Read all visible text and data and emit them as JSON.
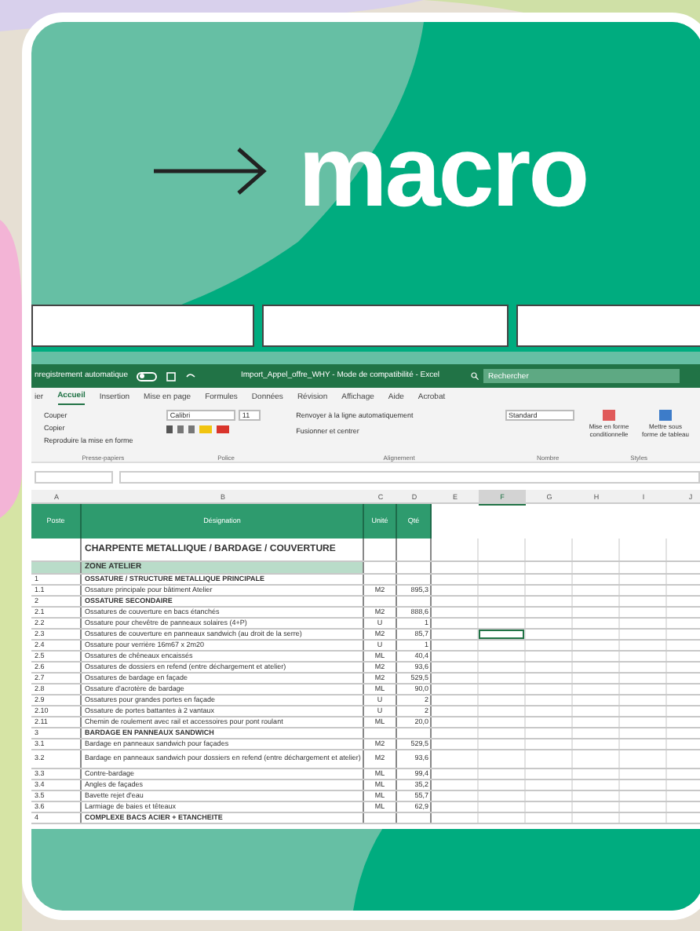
{
  "headline": {
    "word": "macro"
  },
  "excel": {
    "title_bar": {
      "autosave_label": "nregistrement automatique",
      "autosave_on": false,
      "file_title": "Import_Appel_offre_WHY  -  Mode de compatibilité  -  Excel",
      "search_placeholder": "Rechercher"
    },
    "tabs": [
      {
        "label": "ier",
        "selected": false
      },
      {
        "label": "Accueil",
        "selected": true
      },
      {
        "label": "Insertion",
        "selected": false
      },
      {
        "label": "Mise en page",
        "selected": false
      },
      {
        "label": "Formules",
        "selected": false
      },
      {
        "label": "Données",
        "selected": false
      },
      {
        "label": "Révision",
        "selected": false
      },
      {
        "label": "Affichage",
        "selected": false
      },
      {
        "label": "Aide",
        "selected": false
      },
      {
        "label": "Acrobat",
        "selected": false
      }
    ],
    "ribbon": {
      "clipboard": [
        "Couper",
        "Copier",
        "Reproduire la mise en forme"
      ],
      "font_name": "Calibri",
      "font_size": "11",
      "wrap_text": "Renvoyer à la ligne automatiquement",
      "merge": "Fusionner et centrer",
      "number_format": "Standard",
      "conditional": "Mise en forme conditionnelle",
      "as_table": "Mettre sous forme de tableau",
      "groups": [
        "Presse-papiers",
        "Police",
        "Alignement",
        "Nombre",
        "Styles"
      ]
    },
    "column_letters": [
      {
        "label": "A",
        "selected": false
      },
      {
        "label": "B",
        "selected": false
      },
      {
        "label": "C",
        "selected": false
      },
      {
        "label": "D",
        "selected": false
      },
      {
        "label": "E",
        "selected": false
      },
      {
        "label": "F",
        "selected": true
      },
      {
        "label": "G",
        "selected": false
      },
      {
        "label": "H",
        "selected": false
      },
      {
        "label": "I",
        "selected": false
      },
      {
        "label": "J",
        "selected": false
      }
    ],
    "columns": [
      "Poste",
      "Désignation",
      "Unité",
      "Qté"
    ],
    "rows": [
      {
        "kind": "title",
        "designation": "CHARPENTE METALLIQUE / BARDAGE / COUVERTURE"
      },
      {
        "kind": "section",
        "designation": "ZONE ATELIER"
      },
      {
        "kind": "group",
        "poste": "1",
        "designation": "OSSATURE / STRUCTURE METALLIQUE PRINCIPALE"
      },
      {
        "kind": "item",
        "poste": "1.1",
        "designation": "Ossature principale pour bâtiment Atelier",
        "unite": "M2",
        "qte": "895,3"
      },
      {
        "kind": "group",
        "poste": "2",
        "designation": "OSSATURE SECONDAIRE"
      },
      {
        "kind": "item",
        "poste": "2.1",
        "designation": "Ossatures de couverture en bacs étanchés",
        "unite": "M2",
        "qte": "888,6"
      },
      {
        "kind": "item",
        "poste": "2.2",
        "designation": "Ossature pour chevêtre de panneaux solaires (4+P)",
        "unite": "U",
        "qte": "1"
      },
      {
        "kind": "item",
        "poste": "2.3",
        "designation": "Ossatures de couverture en panneaux sandwich (au droit de la serre)",
        "unite": "M2",
        "qte": "85,7",
        "cursor": true
      },
      {
        "kind": "item",
        "poste": "2.4",
        "designation": "Ossature pour verrière 16m67 x 2m20",
        "unite": "U",
        "qte": "1"
      },
      {
        "kind": "item",
        "poste": "2.5",
        "designation": "Ossatures de chêneaux encaissés",
        "unite": "ML",
        "qte": "40,4"
      },
      {
        "kind": "item",
        "poste": "2.6",
        "designation": "Ossatures de dossiers en refend (entre déchargement et atelier)",
        "unite": "M2",
        "qte": "93,6"
      },
      {
        "kind": "item",
        "poste": "2.7",
        "designation": "Ossatures de bardage en façade",
        "unite": "M2",
        "qte": "529,5"
      },
      {
        "kind": "item",
        "poste": "2.8",
        "designation": "Ossature d'acrotère de bardage",
        "unite": "ML",
        "qte": "90,0"
      },
      {
        "kind": "item",
        "poste": "2.9",
        "designation": "Ossatures pour grandes portes en façade",
        "unite": "U",
        "qte": "2"
      },
      {
        "kind": "item",
        "poste": "2.10",
        "designation": "Ossature de portes battantes à 2 vantaux",
        "unite": "U",
        "qte": "2"
      },
      {
        "kind": "item",
        "poste": "2.11",
        "designation": "Chemin de roulement avec rail et accessoires pour pont roulant",
        "unite": "ML",
        "qte": "20,0"
      },
      {
        "kind": "group",
        "poste": "3",
        "designation": "BARDAGE EN PANNEAUX SANDWICH"
      },
      {
        "kind": "item",
        "poste": "3.1",
        "designation": "Bardage en panneaux sandwich pour façades",
        "unite": "M2",
        "qte": "529,5"
      },
      {
        "kind": "tall",
        "poste": "3.2",
        "designation": "Bardage en panneaux sandwich pour dossiers en refend (entre déchargement et atelier)",
        "unite": "M2",
        "qte": "93,6"
      },
      {
        "kind": "item",
        "poste": "3.3",
        "designation": "Contre-bardage",
        "unite": "ML",
        "qte": "99,4"
      },
      {
        "kind": "item",
        "poste": "3.4",
        "designation": "Angles de façades",
        "unite": "ML",
        "qte": "35,2"
      },
      {
        "kind": "item",
        "poste": "3.5",
        "designation": "Bavette rejet d'eau",
        "unite": "ML",
        "qte": "55,7"
      },
      {
        "kind": "item",
        "poste": "3.6",
        "designation": "Larmiage de baies et têteaux",
        "unite": "ML",
        "qte": "62,9"
      },
      {
        "kind": "group",
        "poste": "4",
        "designation": "COMPLEXE BACS ACIER + ETANCHEITE"
      }
    ]
  }
}
